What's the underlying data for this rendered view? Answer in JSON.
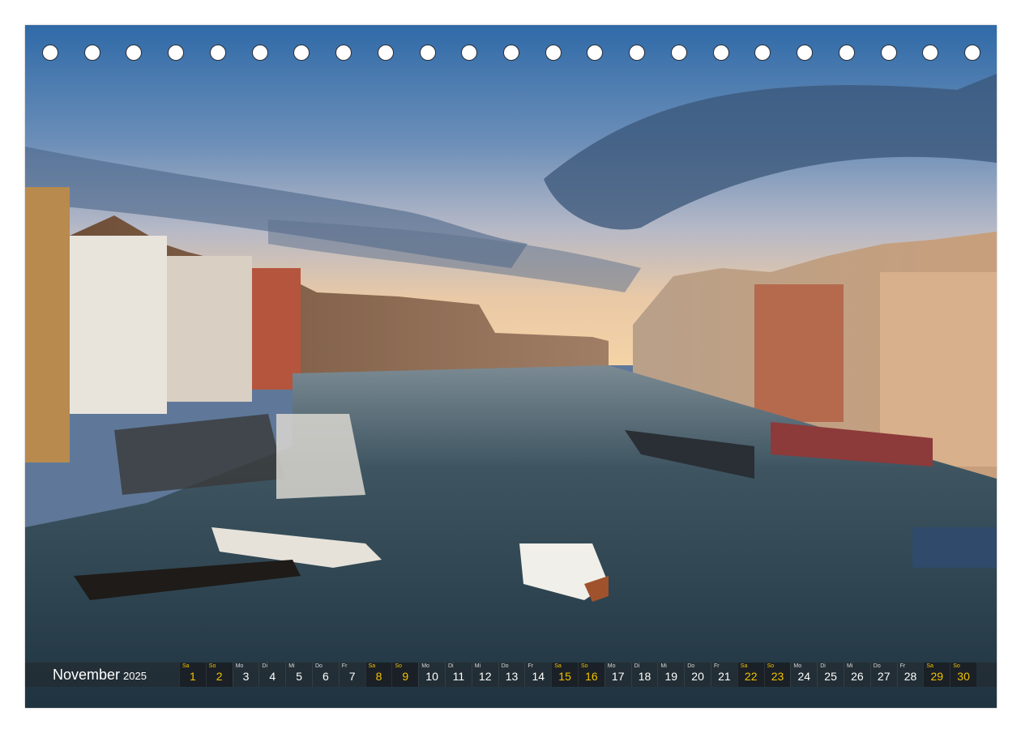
{
  "calendar": {
    "month": "November",
    "year": "2025",
    "weekend_color": "#f2c200",
    "text_color": "#ffffff",
    "days": [
      {
        "dn": "Sa",
        "num": "1",
        "weekend": true
      },
      {
        "dn": "So",
        "num": "2",
        "weekend": true
      },
      {
        "dn": "Mo",
        "num": "3",
        "weekend": false
      },
      {
        "dn": "Di",
        "num": "4",
        "weekend": false
      },
      {
        "dn": "Mi",
        "num": "5",
        "weekend": false
      },
      {
        "dn": "Do",
        "num": "6",
        "weekend": false
      },
      {
        "dn": "Fr",
        "num": "7",
        "weekend": false
      },
      {
        "dn": "Sa",
        "num": "8",
        "weekend": true
      },
      {
        "dn": "So",
        "num": "9",
        "weekend": true
      },
      {
        "dn": "Mo",
        "num": "10",
        "weekend": false
      },
      {
        "dn": "Di",
        "num": "11",
        "weekend": false
      },
      {
        "dn": "Mi",
        "num": "12",
        "weekend": false
      },
      {
        "dn": "Do",
        "num": "13",
        "weekend": false
      },
      {
        "dn": "Fr",
        "num": "14",
        "weekend": false
      },
      {
        "dn": "Sa",
        "num": "15",
        "weekend": true
      },
      {
        "dn": "So",
        "num": "16",
        "weekend": true
      },
      {
        "dn": "Mo",
        "num": "17",
        "weekend": false
      },
      {
        "dn": "Di",
        "num": "18",
        "weekend": false
      },
      {
        "dn": "Mi",
        "num": "19",
        "weekend": false
      },
      {
        "dn": "Do",
        "num": "20",
        "weekend": false
      },
      {
        "dn": "Fr",
        "num": "21",
        "weekend": false
      },
      {
        "dn": "Sa",
        "num": "22",
        "weekend": true
      },
      {
        "dn": "So",
        "num": "23",
        "weekend": true
      },
      {
        "dn": "Mo",
        "num": "24",
        "weekend": false
      },
      {
        "dn": "Di",
        "num": "25",
        "weekend": false
      },
      {
        "dn": "Mi",
        "num": "26",
        "weekend": false
      },
      {
        "dn": "Do",
        "num": "27",
        "weekend": false
      },
      {
        "dn": "Fr",
        "num": "28",
        "weekend": false
      },
      {
        "dn": "Sa",
        "num": "29",
        "weekend": true
      },
      {
        "dn": "So",
        "num": "30",
        "weekend": true
      }
    ]
  },
  "binding": {
    "hole_count": 23
  }
}
